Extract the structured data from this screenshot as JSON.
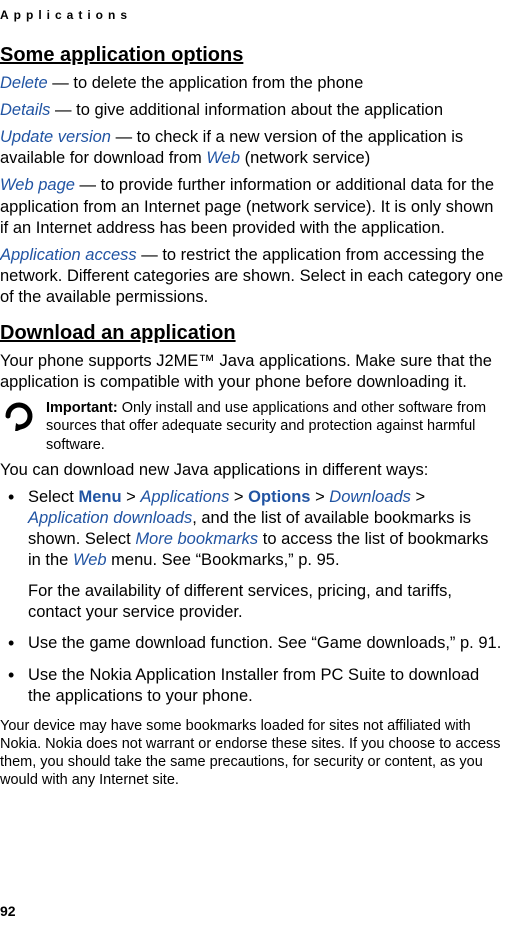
{
  "chapter": "Applications",
  "section1": {
    "heading": "Some application options",
    "items": [
      {
        "term": "Delete",
        "desc": " — to delete the application from the phone"
      },
      {
        "term": "Details",
        "desc": " — to give additional information about the application"
      },
      {
        "term": "Update version",
        "desc_a": " — to check if a new version of the application is available for download from ",
        "link": "Web",
        "desc_b": " (network service)"
      },
      {
        "term": "Web page",
        "desc": " — to provide further information or additional data for the application from an Internet page (network service). It is only shown if an Internet address has been provided with the application."
      },
      {
        "term": "Application access",
        "desc": " — to restrict the application from accessing the network. Different categories are shown. Select in each category one of the available permissions."
      }
    ]
  },
  "section2": {
    "heading": "Download an application",
    "intro": "Your phone supports J2ME™ Java applications. Make sure that the application is compatible with your phone before downloading it.",
    "important_label": "Important:",
    "important_text": " Only install and use applications and other software from sources that offer adequate security and protection against harmful software.",
    "lead": "You can download new Java applications in different ways:",
    "bullet1": {
      "pre": "Select ",
      "menu": "Menu",
      "sep": " > ",
      "apps": "Applications",
      "options": "Options",
      "downloads": "Downloads",
      "appdl": "Application downloads",
      "mid": ", and the list of available bookmarks is shown. Select ",
      "more": "More bookmarks",
      "mid2": " to access the list of bookmarks in the ",
      "web": "Web",
      "end": " menu. See “Bookmarks,” p. 95.",
      "sub": "For the availability of different services, pricing, and tariffs, contact your service provider."
    },
    "bullet2": "Use the game download function. See “Game downloads,” p. 91.",
    "bullet3": "Use the Nokia Application Installer from PC Suite to download the applications to your phone.",
    "fineprint": "Your device may have some bookmarks loaded for sites not affiliated with Nokia. Nokia does not warrant or endorse these sites. If you choose to access them, you should take the same precautions, for security or content, as you would with any Internet site."
  },
  "page_number": "92"
}
